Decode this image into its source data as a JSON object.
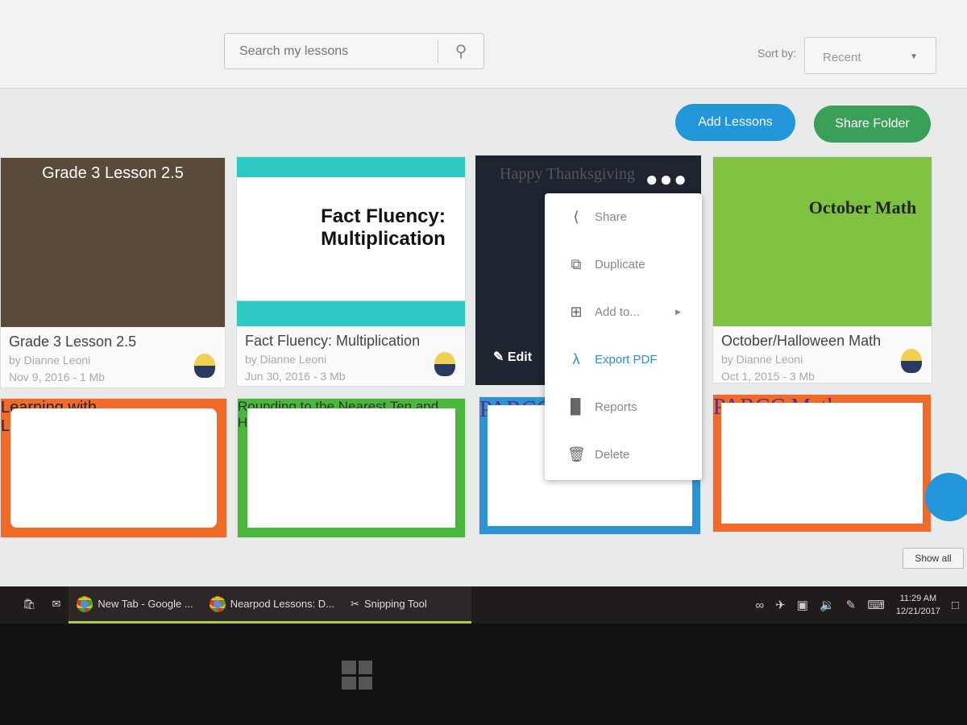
{
  "search": {
    "placeholder": "Search my lessons"
  },
  "sort": {
    "label": "Sort by:",
    "value": "Recent"
  },
  "buttons": {
    "add_lessons": "Add Lessons",
    "share_folder": "Share Folder",
    "show_all": "Show all"
  },
  "lessons": [
    {
      "title": "Grade 3 Lesson 2.5",
      "thumb_text": "Grade 3 Lesson 2.5",
      "author": "by Dianne Leoni",
      "meta": "Nov 9, 2016 - 1 Mb",
      "color": "#5a4a3a"
    },
    {
      "title": "Fact Fluency: Multiplication",
      "thumb_text": "Fact Fluency: Multiplication",
      "author": "by Dianne Leoni",
      "meta": "Jun 30, 2016 - 3 Mb",
      "color": "#2fc9c4"
    },
    {
      "title": "",
      "thumb_text": "Happy Thanksgiving",
      "edit_label": "Edit",
      "color": "#1e2430"
    },
    {
      "title": "October/Halloween Math",
      "thumb_text": "October Math",
      "author": "by Dianne Leoni",
      "meta": "Oct 1, 2015 - 3 Mb",
      "color": "#7fc241"
    },
    {
      "thumb_text": "Learning with Line Plots",
      "color": "#f26a2a"
    },
    {
      "thumb_text": "Rounding to the Nearest Ten and Hundred",
      "color": "#49b83a"
    },
    {
      "thumb_text": "PARCC",
      "color": "#2b93d6"
    },
    {
      "thumb_text": "PARCC Math",
      "color": "#f26a2a"
    }
  ],
  "menu": {
    "items": [
      {
        "label": "Share",
        "icon": "share-icon"
      },
      {
        "label": "Duplicate",
        "icon": "duplicate-icon"
      },
      {
        "label": "Add to...",
        "icon": "add-icon"
      },
      {
        "label": "Export PDF",
        "icon": "pdf-icon"
      },
      {
        "label": "Reports",
        "icon": "reports-icon"
      },
      {
        "label": "Delete",
        "icon": "trash-icon"
      }
    ]
  },
  "taskbar": {
    "items": [
      "New Tab - Google ...",
      "Nearpod Lessons: D...",
      "Snipping Tool"
    ],
    "time": "11:29 AM",
    "date": "12/21/2017"
  }
}
